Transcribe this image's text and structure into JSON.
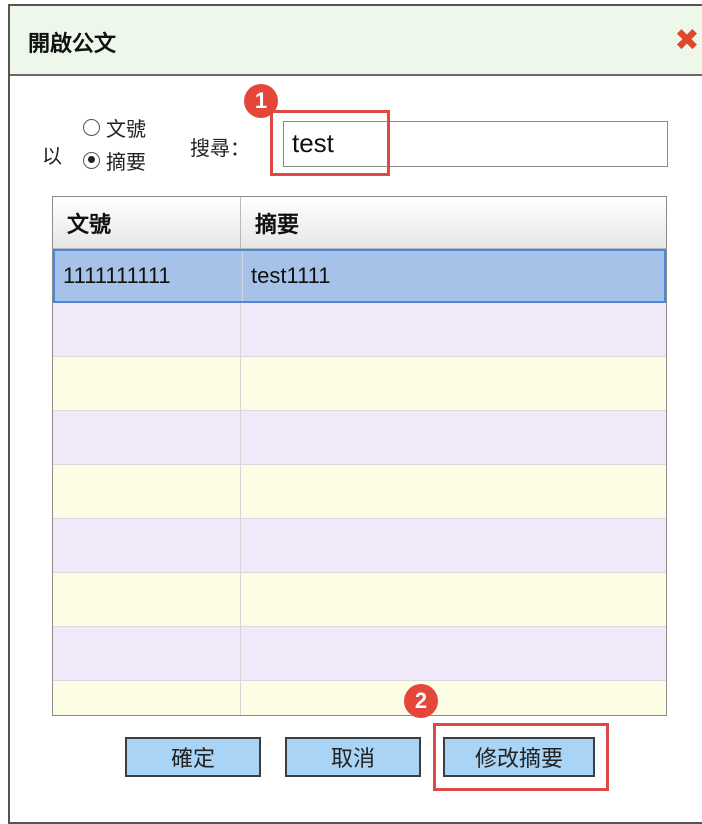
{
  "dialog": {
    "title": "開啟公文",
    "close_glyph": "✖"
  },
  "search": {
    "by_label": "以",
    "options": [
      {
        "label": "文號",
        "selected": false
      },
      {
        "label": "摘要",
        "selected": true
      }
    ],
    "search_label": "搜尋：",
    "value": "test"
  },
  "table": {
    "headers": [
      "文號",
      "摘要"
    ],
    "rows": [
      {
        "doc_no": "1111111111",
        "summary": "test1111",
        "selected": true
      }
    ],
    "empty_rows": 8
  },
  "buttons": {
    "ok": "確定",
    "cancel": "取消",
    "edit_summary": "修改摘要"
  },
  "annotations": {
    "step1": "1",
    "step2": "2",
    "color": "#e04747"
  }
}
